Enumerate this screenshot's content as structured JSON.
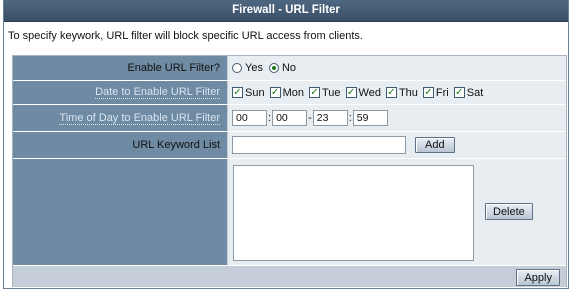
{
  "title": "Firewall - URL Filter",
  "description": "To specify keywork, URL filter will block specific URL access from clients.",
  "enable": {
    "label": "Enable URL Filter?",
    "yes": "Yes",
    "no": "No",
    "selected": "No"
  },
  "dates": {
    "label": "Date to Enable URL Filter",
    "days": [
      {
        "name": "Sun",
        "checked": true
      },
      {
        "name": "Mon",
        "checked": true
      },
      {
        "name": "Tue",
        "checked": true
      },
      {
        "name": "Wed",
        "checked": true
      },
      {
        "name": "Thu",
        "checked": true
      },
      {
        "name": "Fri",
        "checked": true
      },
      {
        "name": "Sat",
        "checked": true
      }
    ]
  },
  "time": {
    "label": "Time of Day to Enable URL Filter",
    "start_hour": "00",
    "start_min": "00",
    "end_hour": "23",
    "end_min": "59"
  },
  "keyword": {
    "label": "URL Keyword List",
    "value": "",
    "add_label": "Add"
  },
  "list": {
    "items": [],
    "delete_label": "Delete"
  },
  "apply_label": "Apply",
  "colors": {
    "titlebar": "#4f6781",
    "label_cell": "#6f8aa3",
    "value_cell": "#e8edf2",
    "check": "#1b7a1b"
  }
}
